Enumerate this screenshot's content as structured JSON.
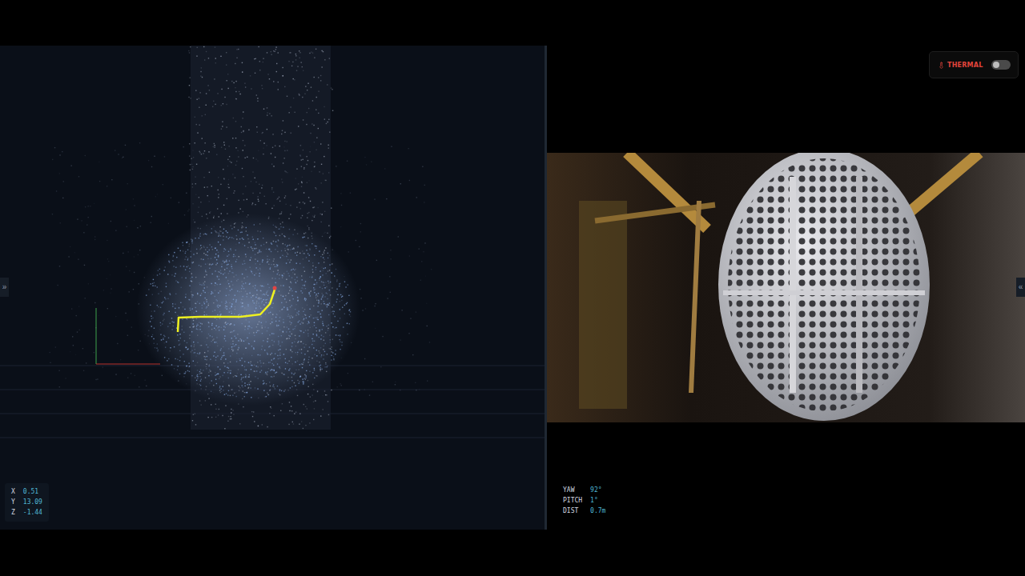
{
  "viewer": {
    "expand": "»",
    "coordinates": [
      {
        "axis": "X",
        "value": "0.51"
      },
      {
        "axis": "Y",
        "value": "13.09"
      },
      {
        "axis": "Z",
        "value": "-1.44"
      }
    ]
  },
  "camera": {
    "expand": "«",
    "thermal": {
      "label": "THERMAL",
      "on": false
    },
    "telemetry": [
      {
        "label": "YAW",
        "value": "92°"
      },
      {
        "label": "PITCH",
        "value": "1°"
      },
      {
        "label": "DIST",
        "value": "0.7m"
      }
    ]
  }
}
